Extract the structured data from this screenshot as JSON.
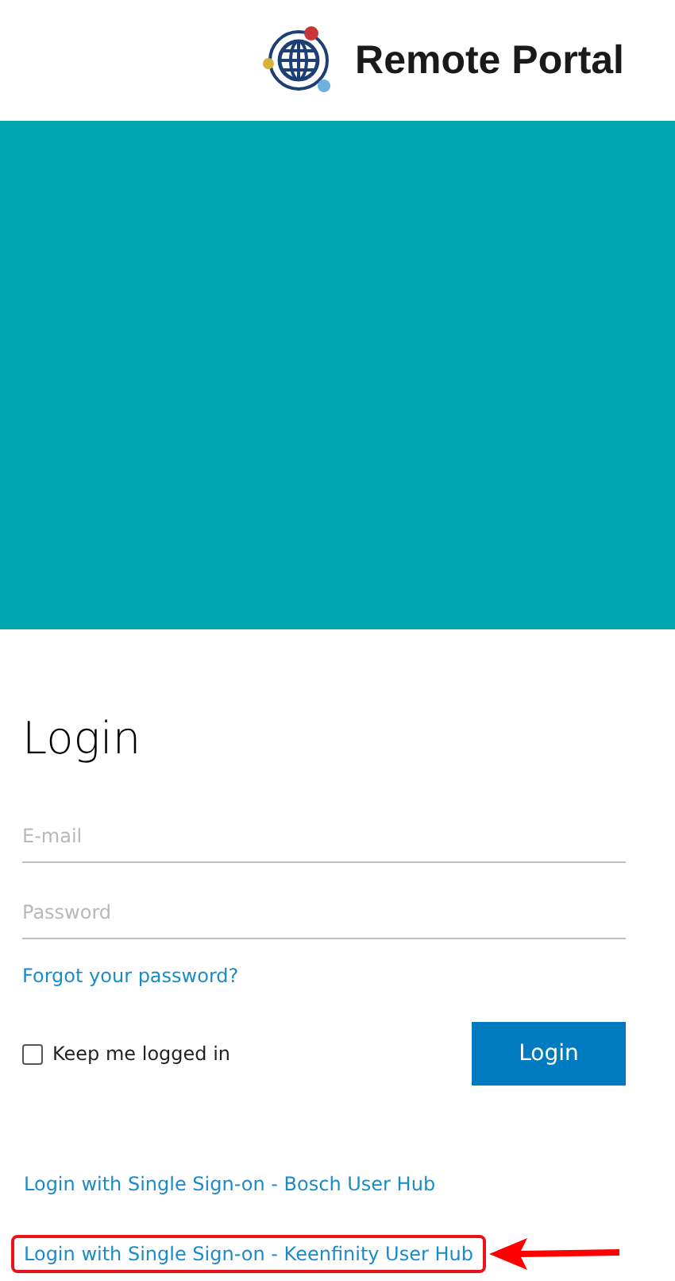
{
  "header": {
    "brand": "Remote Portal"
  },
  "login": {
    "title": "Login",
    "fields": [
      {
        "placeholder": "E-mail"
      },
      {
        "placeholder": "Password"
      }
    ],
    "forgot_link": "Forgot your password?",
    "keep_logged_in": {
      "label": "Keep me logged in",
      "checked": false
    },
    "submit": "Login",
    "sso_links": [
      {
        "label": "Login with Single Sign-on - Bosch User Hub",
        "highlighted": false
      },
      {
        "label": "Login with Single Sign-on - Keenfinity User Hub",
        "highlighted": true
      }
    ]
  }
}
